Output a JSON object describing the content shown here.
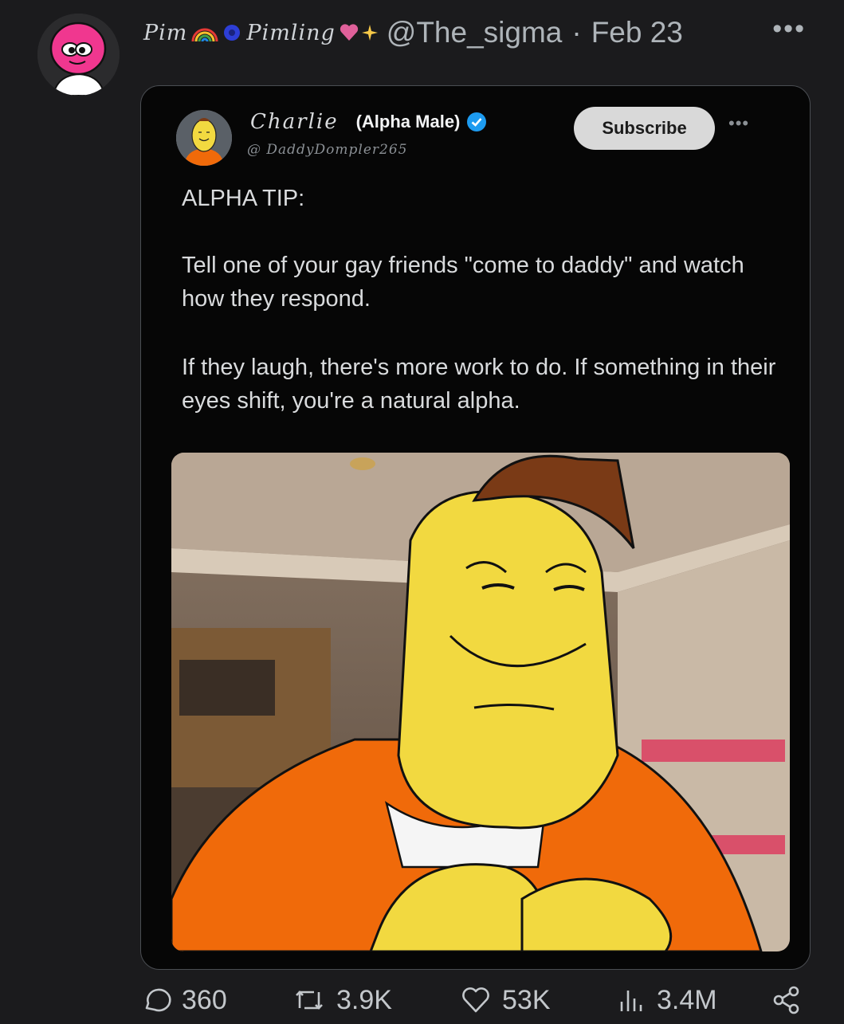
{
  "post": {
    "author": {
      "display_name": "Pim",
      "display_name_2": "Pimling",
      "handle": "@The_sigma",
      "separator": "·",
      "date": "Feb 23",
      "avatar_icon": "pink-blob-avatar"
    },
    "more_icon": "•••",
    "stats": {
      "replies": "360",
      "reposts": "3.9K",
      "likes": "53K",
      "views": "3.4M"
    }
  },
  "quoted": {
    "name_script": "Charlie",
    "name_bold": "(Alpha Male)",
    "handle": "@ DaddyDompler265",
    "subscribe_label": "Subscribe",
    "more_icon": "•••",
    "text": {
      "heading": "ALPHA TIP:",
      "paragraph_1": "Tell one of your gay friends \"come to daddy\" and watch how they respond.",
      "paragraph_2": "If they laugh, there's more work to do. If something in their eyes shift, you're a natural alpha."
    },
    "colors": {
      "verified": "#1d9bf0",
      "character_yellow": "#f2d940",
      "jacket_orange": "#f06a0a",
      "hat_brown": "#7a3a16"
    }
  }
}
